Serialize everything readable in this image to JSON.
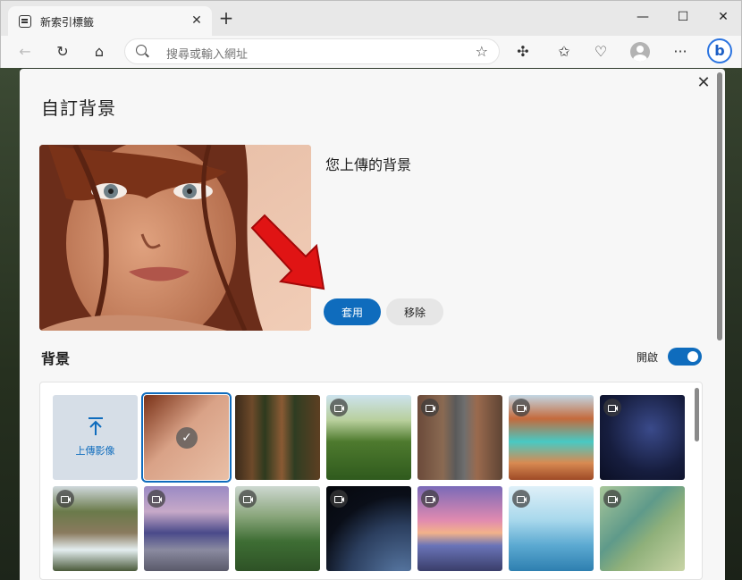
{
  "browser": {
    "tab_title": "新索引標籤",
    "address_placeholder": "搜尋或輸入網址",
    "window_controls": [
      "minimize",
      "maximize",
      "close"
    ],
    "toolbar_icons": [
      "back-icon",
      "refresh-icon",
      "home-icon",
      "extensions-icon",
      "favorites-icon",
      "browser-essentials-icon",
      "profile-icon",
      "more-icon",
      "bing-icon"
    ]
  },
  "dialog": {
    "title": "自訂背景",
    "uploaded_heading": "您上傳的背景",
    "apply_label": "套用",
    "remove_label": "移除",
    "section_title": "背景",
    "toggle_label": "開啟",
    "toggle_on": true,
    "upload_tile_label": "上傳影像",
    "tiles": [
      {
        "name": "uploaded-portrait",
        "video": false,
        "selected": true
      },
      {
        "name": "redwood-forest-path",
        "video": false,
        "selected": false
      },
      {
        "name": "green-valley-mountain",
        "video": true,
        "selected": false
      },
      {
        "name": "aerial-highway",
        "video": true,
        "selected": false
      },
      {
        "name": "turquoise-canyon-lake",
        "video": true,
        "selected": false
      },
      {
        "name": "starry-night-sky",
        "video": true,
        "selected": false
      },
      {
        "name": "waterfall-cliff",
        "video": true,
        "selected": false
      },
      {
        "name": "misty-terraces-sunset",
        "video": true,
        "selected": false
      },
      {
        "name": "green-hills",
        "video": true,
        "selected": false
      },
      {
        "name": "earth-from-space",
        "video": true,
        "selected": false
      },
      {
        "name": "pier-sunset",
        "video": true,
        "selected": false
      },
      {
        "name": "glacier-birds",
        "video": true,
        "selected": false
      },
      {
        "name": "river-delta-aerial",
        "video": true,
        "selected": false
      }
    ]
  },
  "colors": {
    "accent": "#0f6cbd",
    "arrow": "#e01414"
  }
}
